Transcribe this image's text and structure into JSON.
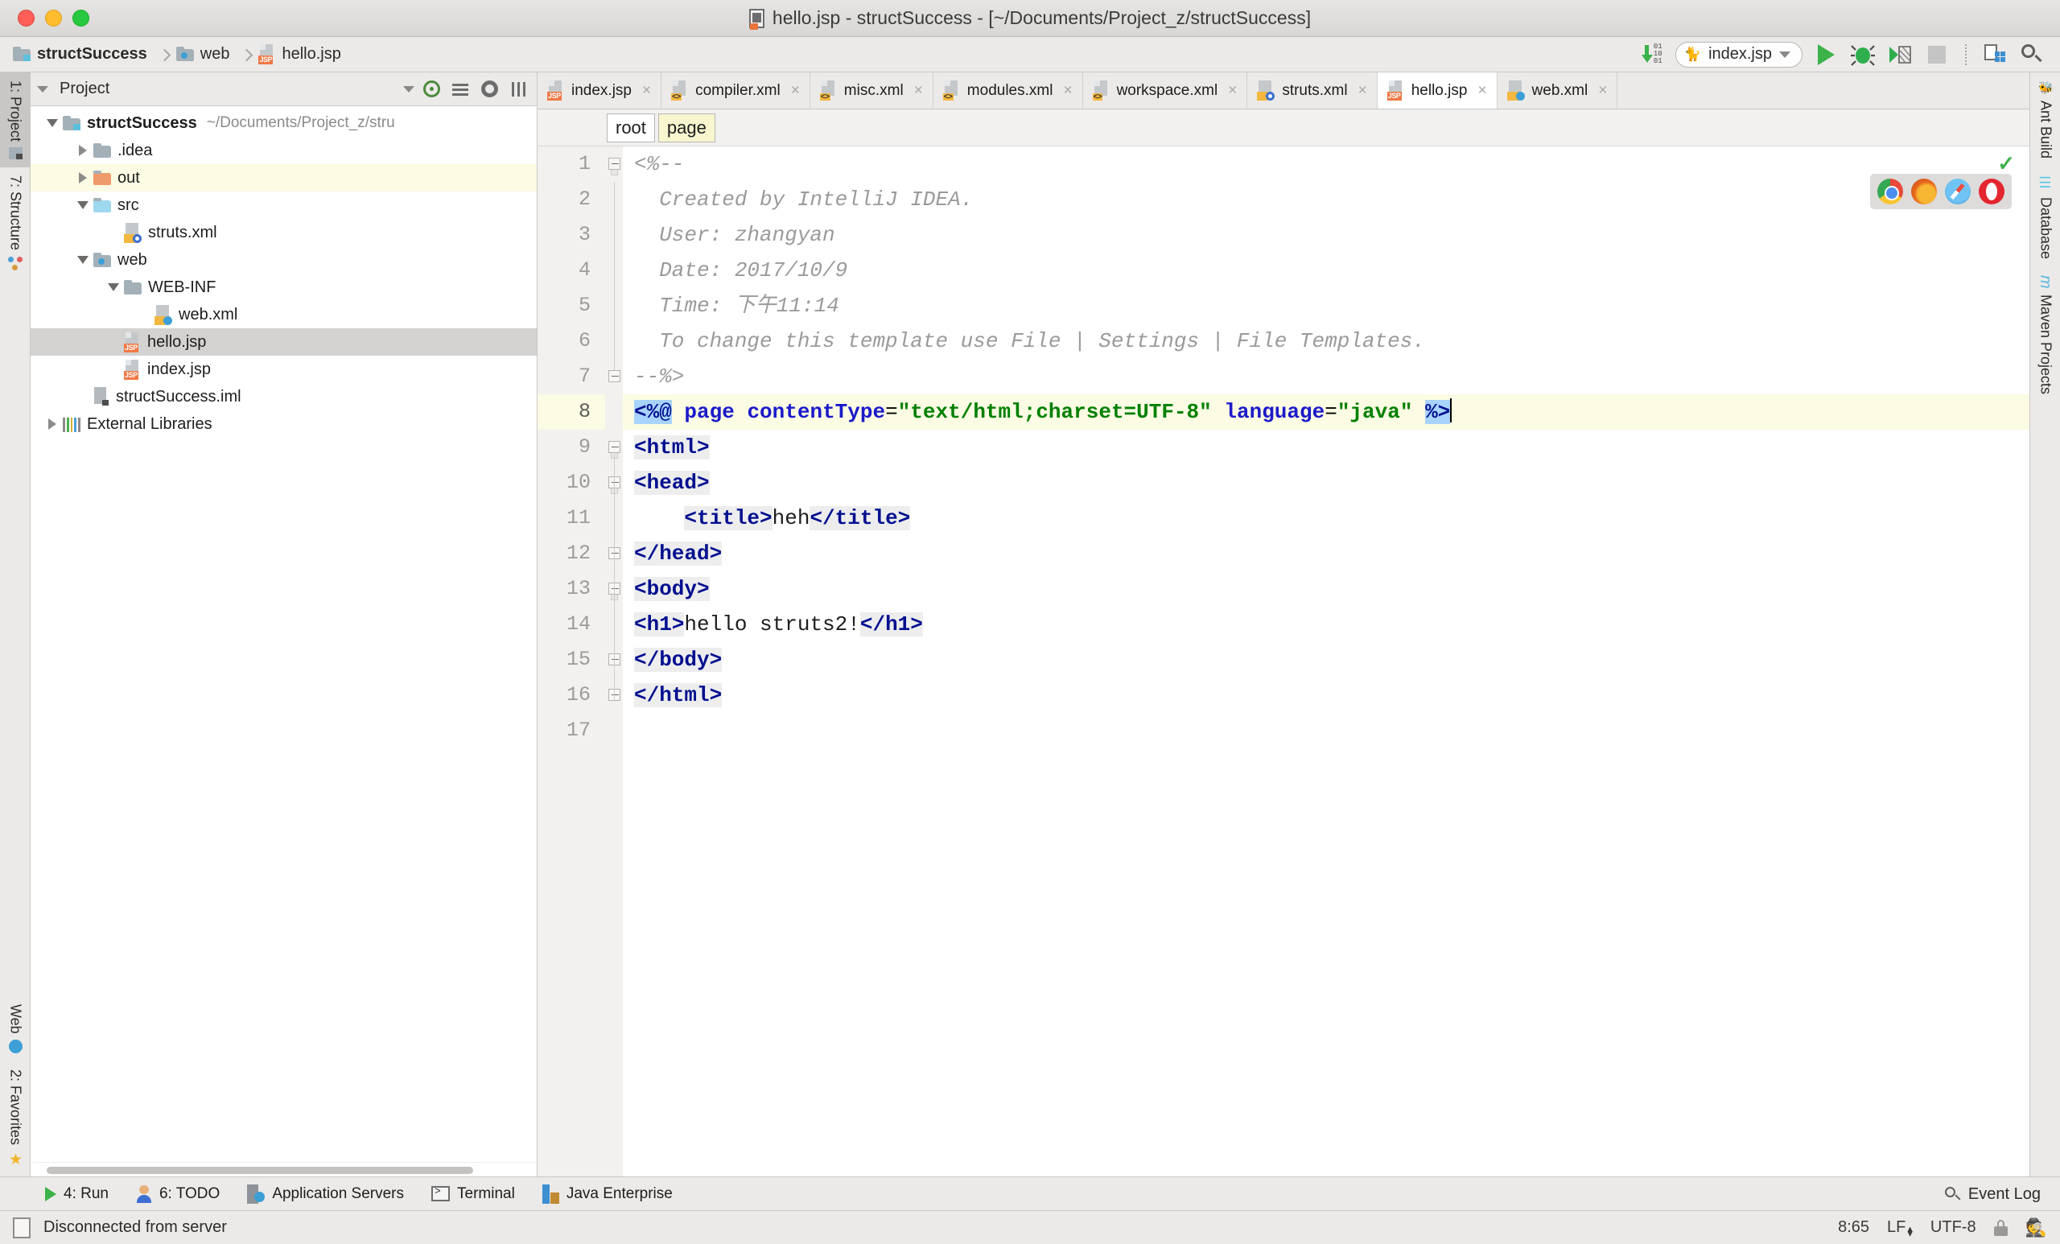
{
  "window": {
    "title": "hello.jsp - structSuccess - [~/Documents/Project_z/structSuccess]",
    "traffic": {
      "close": "close-window",
      "minimize": "minimize-window",
      "maximize": "maximize-window"
    }
  },
  "navbar": {
    "breadcrumbs": [
      {
        "label": "structSuccess",
        "icon": "module-folder-icon"
      },
      {
        "label": "web",
        "icon": "web-folder-icon"
      },
      {
        "label": "hello.jsp",
        "icon": "jsp-file-icon"
      }
    ],
    "download_bits": "01\n10\n01",
    "run_config": "index.jsp",
    "buttons": [
      "run-button",
      "debug-button",
      "run-with-coverage-button",
      "stop-button",
      "layout-button",
      "search-everywhere-button"
    ]
  },
  "left_rail": {
    "top": [
      {
        "label": "1: Project",
        "icon": "project-icon",
        "active": true
      },
      {
        "label": "7: Structure",
        "icon": "structure-icon",
        "active": false
      }
    ],
    "bottom": [
      {
        "label": "Web",
        "icon": "web-globe-icon",
        "active": false
      },
      {
        "label": "2: Favorites",
        "icon": "star-icon",
        "active": false
      }
    ]
  },
  "right_rail": {
    "items": [
      {
        "label": "Ant Build",
        "icon": "ant-icon"
      },
      {
        "label": "Database",
        "icon": "database-icon"
      },
      {
        "label": "Maven Projects",
        "icon": "maven-icon"
      }
    ]
  },
  "project_panel": {
    "title": "Project",
    "header_icons": [
      "scroll-from-source-icon",
      "collapse-all-icon",
      "settings-gear-icon",
      "hide-panel-icon"
    ],
    "tree": [
      {
        "indent": 0,
        "toggle": "down",
        "icon": "module-folder-icon",
        "label": "structSuccess",
        "bold": true,
        "path": "~/Documents/Project_z/stru",
        "state": "normal"
      },
      {
        "indent": 1,
        "toggle": "right",
        "icon": "folder-icon",
        "label": ".idea",
        "bold": false,
        "path": "",
        "state": "normal"
      },
      {
        "indent": 1,
        "toggle": "right",
        "icon": "out-folder-icon",
        "label": "out",
        "bold": false,
        "path": "",
        "state": "highlight"
      },
      {
        "indent": 1,
        "toggle": "down",
        "icon": "source-folder-icon",
        "label": "src",
        "bold": false,
        "path": "",
        "state": "normal"
      },
      {
        "indent": 2,
        "toggle": "none",
        "icon": "struts-xml-icon",
        "label": "struts.xml",
        "bold": false,
        "path": "",
        "state": "normal"
      },
      {
        "indent": 1,
        "toggle": "down",
        "icon": "web-folder-icon",
        "label": "web",
        "bold": false,
        "path": "",
        "state": "normal"
      },
      {
        "indent": 2,
        "toggle": "down",
        "icon": "folder-icon",
        "label": "WEB-INF",
        "bold": false,
        "path": "",
        "state": "normal"
      },
      {
        "indent": 3,
        "toggle": "none",
        "icon": "web-xml-icon",
        "label": "web.xml",
        "bold": false,
        "path": "",
        "state": "normal"
      },
      {
        "indent": 2,
        "toggle": "none",
        "icon": "jsp-file-icon",
        "label": "hello.jsp",
        "bold": false,
        "path": "",
        "state": "selected"
      },
      {
        "indent": 2,
        "toggle": "none",
        "icon": "jsp-file-icon",
        "label": "index.jsp",
        "bold": false,
        "path": "",
        "state": "normal"
      },
      {
        "indent": 1,
        "toggle": "none",
        "icon": "iml-file-icon",
        "label": "structSuccess.iml",
        "bold": false,
        "path": "",
        "state": "normal"
      },
      {
        "indent": 0,
        "toggle": "right",
        "icon": "libraries-icon",
        "label": "External Libraries",
        "bold": false,
        "path": "",
        "state": "normal"
      }
    ]
  },
  "editor": {
    "tabs": [
      {
        "label": "index.jsp",
        "icon": "jsp-file-icon",
        "active": false,
        "closable": true
      },
      {
        "label": "compiler.xml",
        "icon": "xml-file-icon",
        "active": false,
        "closable": true
      },
      {
        "label": "misc.xml",
        "icon": "xml-file-icon",
        "active": false,
        "closable": true
      },
      {
        "label": "modules.xml",
        "icon": "xml-file-icon",
        "active": false,
        "closable": true
      },
      {
        "label": "workspace.xml",
        "icon": "xml-file-icon",
        "active": false,
        "closable": true
      },
      {
        "label": "struts.xml",
        "icon": "struts-xml-icon",
        "active": false,
        "closable": true
      },
      {
        "label": "hello.jsp",
        "icon": "jsp-file-icon",
        "active": true,
        "closable": true
      },
      {
        "label": "web.xml",
        "icon": "web-xml-icon",
        "active": false,
        "closable": true
      }
    ],
    "close_glyph": "×",
    "structure_chips": [
      {
        "label": "root",
        "highlight": false
      },
      {
        "label": "page",
        "highlight": true
      }
    ],
    "browsers": [
      "chrome-icon",
      "firefox-icon",
      "safari-icon",
      "opera-icon"
    ],
    "inspection_ok": "✓",
    "total_lines": 17,
    "current_line": 8,
    "code_lines": [
      {
        "n": 1,
        "fold": "start",
        "tokens": [
          {
            "t": "<%--",
            "c": "cmt"
          }
        ]
      },
      {
        "n": 2,
        "fold": "body",
        "tokens": [
          {
            "t": "  Created by IntelliJ IDEA.",
            "c": "cmt"
          }
        ]
      },
      {
        "n": 3,
        "fold": "body",
        "tokens": [
          {
            "t": "  User: zhangyan",
            "c": "cmt"
          }
        ]
      },
      {
        "n": 4,
        "fold": "body",
        "tokens": [
          {
            "t": "  Date: 2017/10/9",
            "c": "cmt"
          }
        ]
      },
      {
        "n": 5,
        "fold": "body",
        "tokens": [
          {
            "t": "  Time: 下午11:14",
            "c": "cmt"
          }
        ]
      },
      {
        "n": 6,
        "fold": "body",
        "tokens": [
          {
            "t": "  To change this template use File | Settings | File Templates.",
            "c": "cmt"
          }
        ]
      },
      {
        "n": 7,
        "fold": "end",
        "tokens": [
          {
            "t": "--%>",
            "c": "cmt"
          }
        ]
      },
      {
        "n": 8,
        "fold": "none",
        "current": true,
        "tokens": [
          {
            "t": "<%@",
            "c": "jspbr"
          },
          {
            "t": " ",
            "c": "plain"
          },
          {
            "t": "page",
            "c": "attr"
          },
          {
            "t": " ",
            "c": "plain"
          },
          {
            "t": "contentType",
            "c": "attr"
          },
          {
            "t": "=",
            "c": "eq"
          },
          {
            "t": "\"text/html;charset=UTF-8\"",
            "c": "str"
          },
          {
            "t": " ",
            "c": "plain"
          },
          {
            "t": "language",
            "c": "attr"
          },
          {
            "t": "=",
            "c": "eq"
          },
          {
            "t": "\"java\"",
            "c": "str"
          },
          {
            "t": " ",
            "c": "plain"
          },
          {
            "t": "%>",
            "c": "jspbr"
          }
        ]
      },
      {
        "n": 9,
        "fold": "start",
        "tokens": [
          {
            "t": "<html>",
            "c": "tagn"
          }
        ]
      },
      {
        "n": 10,
        "fold": "start",
        "tokens": [
          {
            "t": "<head>",
            "c": "tagn"
          }
        ]
      },
      {
        "n": 11,
        "fold": "none",
        "tokens": [
          {
            "t": "    ",
            "c": "plain"
          },
          {
            "t": "<title>",
            "c": "tagn"
          },
          {
            "t": "heh",
            "c": "txt"
          },
          {
            "t": "</title>",
            "c": "tagn"
          }
        ]
      },
      {
        "n": 12,
        "fold": "end",
        "tokens": [
          {
            "t": "</head>",
            "c": "tagn"
          }
        ]
      },
      {
        "n": 13,
        "fold": "start",
        "tokens": [
          {
            "t": "<body>",
            "c": "tagn"
          }
        ]
      },
      {
        "n": 14,
        "fold": "none",
        "tokens": [
          {
            "t": "<h1>",
            "c": "tagn"
          },
          {
            "t": "hello struts2!",
            "c": "txt"
          },
          {
            "t": "</h1>",
            "c": "tagn"
          }
        ]
      },
      {
        "n": 15,
        "fold": "end",
        "tokens": [
          {
            "t": "</body>",
            "c": "tagn"
          }
        ]
      },
      {
        "n": 16,
        "fold": "end",
        "tokens": [
          {
            "t": "</html>",
            "c": "tagn"
          }
        ]
      },
      {
        "n": 17,
        "fold": "none",
        "tokens": []
      }
    ]
  },
  "tool_window_bar": {
    "items": [
      {
        "label": "4: Run",
        "mnemonic": "4",
        "icon": "run-icon"
      },
      {
        "label": "6: TODO",
        "mnemonic": "6",
        "icon": "todo-icon"
      },
      {
        "label": "Application Servers",
        "mnemonic": "",
        "icon": "application-servers-icon"
      },
      {
        "label": "Terminal",
        "mnemonic": "",
        "icon": "terminal-icon"
      },
      {
        "label": "Java Enterprise",
        "mnemonic": "",
        "icon": "java-enterprise-icon"
      }
    ]
  },
  "status_bar": {
    "message": "Disconnected from server",
    "caret_position": "8:65",
    "line_separator": "LF",
    "encoding": "UTF-8",
    "lock": "read-write-lock-icon",
    "hector": "hector-inspection-icon",
    "event_log": "Event Log"
  },
  "colors": {
    "chrome_bg": "#eceae8",
    "editor_bg": "#ffffff",
    "accent_green": "#3cb24a",
    "current_line": "#fcfbe3",
    "selection_blue": "#a8d3fb",
    "tag_blue": "#000f8f",
    "attr_blue": "#1a1aca",
    "string_green": "#008000",
    "comment_gray": "#9a9a9a",
    "tree_selected": "#d4d2d0"
  }
}
